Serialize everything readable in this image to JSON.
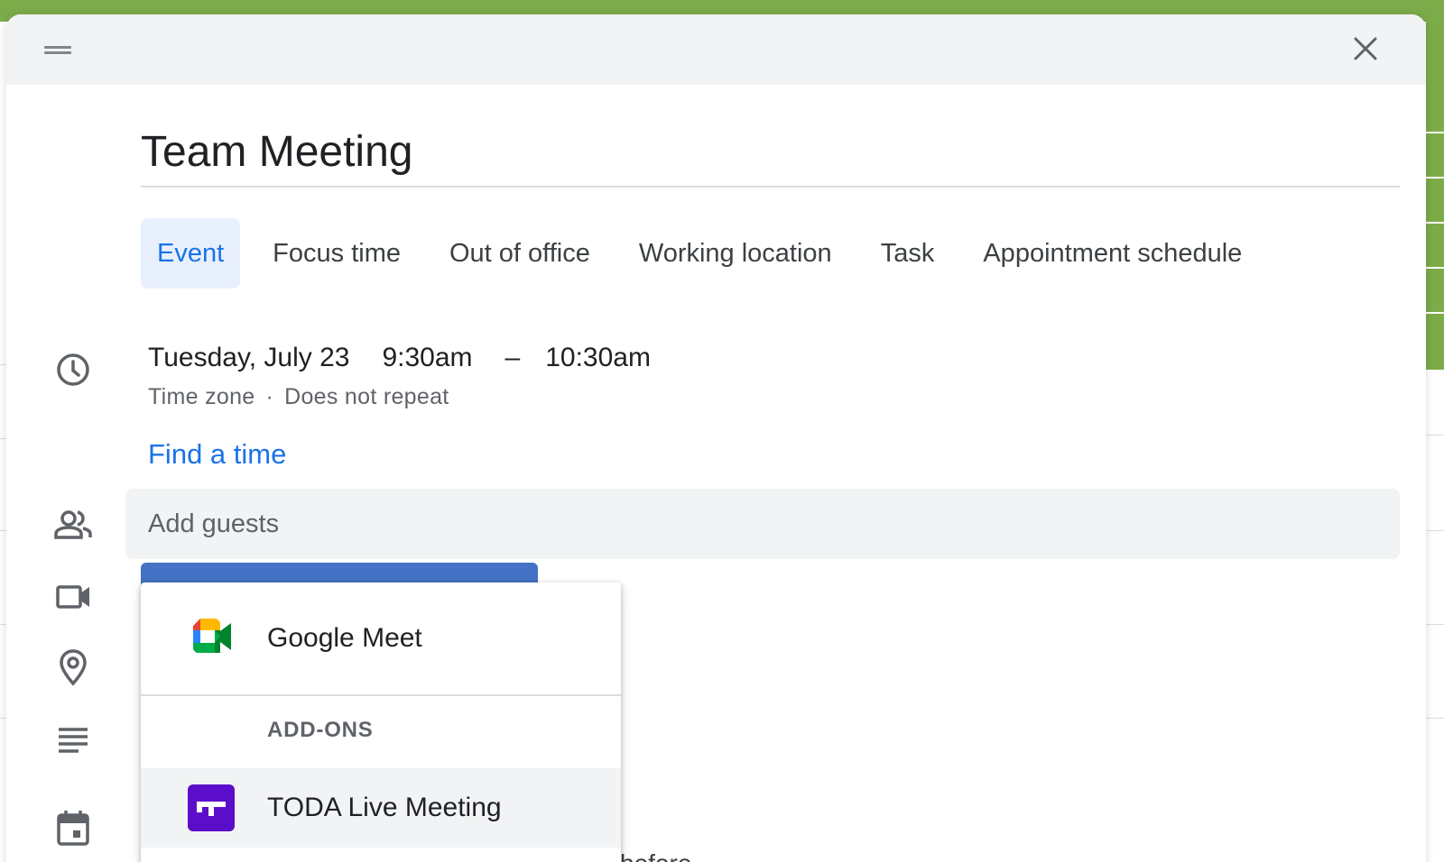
{
  "dialog": {
    "title_value": "Team Meeting"
  },
  "tabs": [
    {
      "label": "Event",
      "active": true
    },
    {
      "label": "Focus time",
      "active": false
    },
    {
      "label": "Out of office",
      "active": false
    },
    {
      "label": "Working location",
      "active": false
    },
    {
      "label": "Task",
      "active": false
    },
    {
      "label": "Appointment schedule",
      "active": false
    }
  ],
  "datetime": {
    "date": "Tuesday, July 23",
    "start": "9:30am",
    "separator": "–",
    "end": "10:30am",
    "time_zone": "Time zone",
    "dot": "·",
    "repeat": "Does not repeat"
  },
  "find_time": "Find a time",
  "guests": {
    "placeholder": "Add guests"
  },
  "conference_menu": {
    "items": [
      {
        "label": "Google Meet",
        "icon": "google-meet-icon"
      }
    ],
    "section_header": "ADD-ONS",
    "addons": [
      {
        "label": "TODA Live Meeting",
        "icon": "toda-icon"
      }
    ]
  },
  "background": {
    "partial_text": "before"
  },
  "icons": {
    "drag": "drag-handle-icon",
    "close": "close-icon",
    "time": "clock-icon",
    "guests": "people-icon",
    "video": "video-camera-icon",
    "location": "location-pin-icon",
    "description": "description-icon",
    "calendar": "calendar-icon"
  },
  "colors": {
    "accent": "#1a73e8",
    "tab_active_bg": "#e8f0fe",
    "header_bg": "#f1f3f4",
    "calendar_green": "#7cab4a",
    "conference_button": "#4472c4",
    "toda_brand": "#5b0ec9"
  }
}
